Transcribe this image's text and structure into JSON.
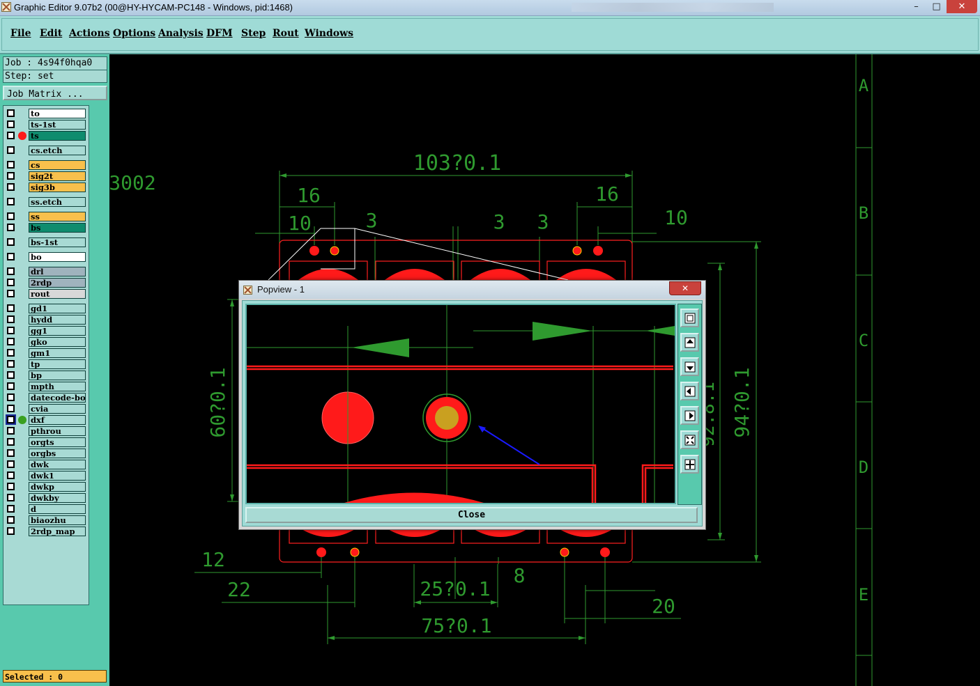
{
  "window": {
    "title": "Graphic Editor 9.07b2 (00@HY-HYCAM-PC148 - Windows, pid:1468)",
    "min_glyph": "–",
    "max_glyph": "□",
    "close_glyph": "✕"
  },
  "menu": [
    "File",
    "Edit",
    "Actions",
    "Options",
    "Analysis",
    "DFM",
    "Step",
    "Rout",
    "Windows"
  ],
  "job": {
    "job_line": "Job : 4s94f0hqa0",
    "step_line": "Step: set"
  },
  "job_matrix_label": "Job Matrix ...",
  "layers": [
    {
      "name": "to",
      "color": "#ffffff",
      "text": "#000000"
    },
    {
      "name": "ts-1st",
      "color": "#a8dad4",
      "text": "#000000"
    },
    {
      "name": "ts",
      "color": "#0f8c6e",
      "text": "#000000",
      "dot": "#ff1a1a"
    },
    {
      "name": "cs.etch",
      "color": "#a8dad4",
      "text": "#000000"
    },
    {
      "name": "cs",
      "color": "#f8c04c",
      "text": "#000000"
    },
    {
      "name": "sig2t",
      "color": "#f8c04c",
      "text": "#000000"
    },
    {
      "name": "sig3b",
      "color": "#f8c04c",
      "text": "#000000"
    },
    {
      "name": "ss.etch",
      "color": "#a8dad4",
      "text": "#000000"
    },
    {
      "name": "ss",
      "color": "#f8c04c",
      "text": "#000000"
    },
    {
      "name": "bs",
      "color": "#0f8c6e",
      "text": "#000000"
    },
    {
      "name": "bs-1st",
      "color": "#a8dad4",
      "text": "#000000"
    },
    {
      "name": "bo",
      "color": "#ffffff",
      "text": "#000000"
    },
    {
      "name": "drl",
      "color": "#9fb3bd",
      "text": "#000000"
    },
    {
      "name": "2rdp",
      "color": "#9fb3bd",
      "text": "#000000"
    },
    {
      "name": "rout",
      "color": "#d8d8d8",
      "text": "#000000"
    },
    {
      "name": "gd1",
      "color": "#a8dad4",
      "text": "#000000"
    },
    {
      "name": "hydd",
      "color": "#a8dad4",
      "text": "#000000"
    },
    {
      "name": "gg1",
      "color": "#a8dad4",
      "text": "#000000"
    },
    {
      "name": "gko",
      "color": "#a8dad4",
      "text": "#000000"
    },
    {
      "name": "gm1",
      "color": "#a8dad4",
      "text": "#000000"
    },
    {
      "name": "tp",
      "color": "#a8dad4",
      "text": "#000000"
    },
    {
      "name": "bp",
      "color": "#a8dad4",
      "text": "#000000"
    },
    {
      "name": "mpth",
      "color": "#a8dad4",
      "text": "#000000"
    },
    {
      "name": "datecode-bo",
      "color": "#a8dad4",
      "text": "#000000"
    },
    {
      "name": "cvia",
      "color": "#a8dad4",
      "text": "#000000"
    },
    {
      "name": "dxf",
      "color": "#a8dad4",
      "text": "#000000",
      "dot": "#3aa020",
      "active": true
    },
    {
      "name": "pthrou",
      "color": "#a8dad4",
      "text": "#000000"
    },
    {
      "name": "orgts",
      "color": "#a8dad4",
      "text": "#000000"
    },
    {
      "name": "orgbs",
      "color": "#a8dad4",
      "text": "#000000"
    },
    {
      "name": "dwk",
      "color": "#a8dad4",
      "text": "#000000"
    },
    {
      "name": "dwk1",
      "color": "#a8dad4",
      "text": "#000000"
    },
    {
      "name": "dwkp",
      "color": "#a8dad4",
      "text": "#000000"
    },
    {
      "name": "dwkby",
      "color": "#a8dad4",
      "text": "#000000"
    },
    {
      "name": "d",
      "color": "#a8dad4",
      "text": "#000000"
    },
    {
      "name": "biaozhu",
      "color": "#a8dad4",
      "text": "#000000"
    },
    {
      "name": "2rdp_map",
      "color": "#a8dad4",
      "text": "#000000"
    }
  ],
  "selected_label": "Selected : 0",
  "drawing": {
    "label_3002": "3002",
    "dim_103": "103?0.1",
    "dim_16_left": "16",
    "dim_16_right": "16",
    "dim_10_left": "10",
    "dim_10_right": "10",
    "dim_3_a": "3",
    "dim_3_b": "3",
    "dim_3_c": "3",
    "dim_60": "60?0.1",
    "dim_94": "94?0.1",
    "dim_partial": "92.8.1",
    "dim_12": "12",
    "dim_22": "22",
    "dim_25": "25?0.1",
    "dim_8": "8",
    "dim_20": "20",
    "dim_75": "75?0.1",
    "row_labels": [
      "A",
      "B",
      "C",
      "D",
      "E"
    ]
  },
  "popview": {
    "title": "Popview - 1",
    "close_glyph": "✕",
    "close_button": "Close",
    "tools": [
      "zoom-fit-icon",
      "pan-up-icon",
      "pan-down-icon",
      "pan-left-icon",
      "pan-right-icon",
      "zoom-in-icon",
      "zoom-out-icon"
    ]
  },
  "colors": {
    "teal_bg": "#58c9ad",
    "menu_bg": "#9fdbd6",
    "dim_green": "#2f9a2f",
    "pad_red": "#ff1a1a",
    "highlight": "#f8c04c"
  }
}
